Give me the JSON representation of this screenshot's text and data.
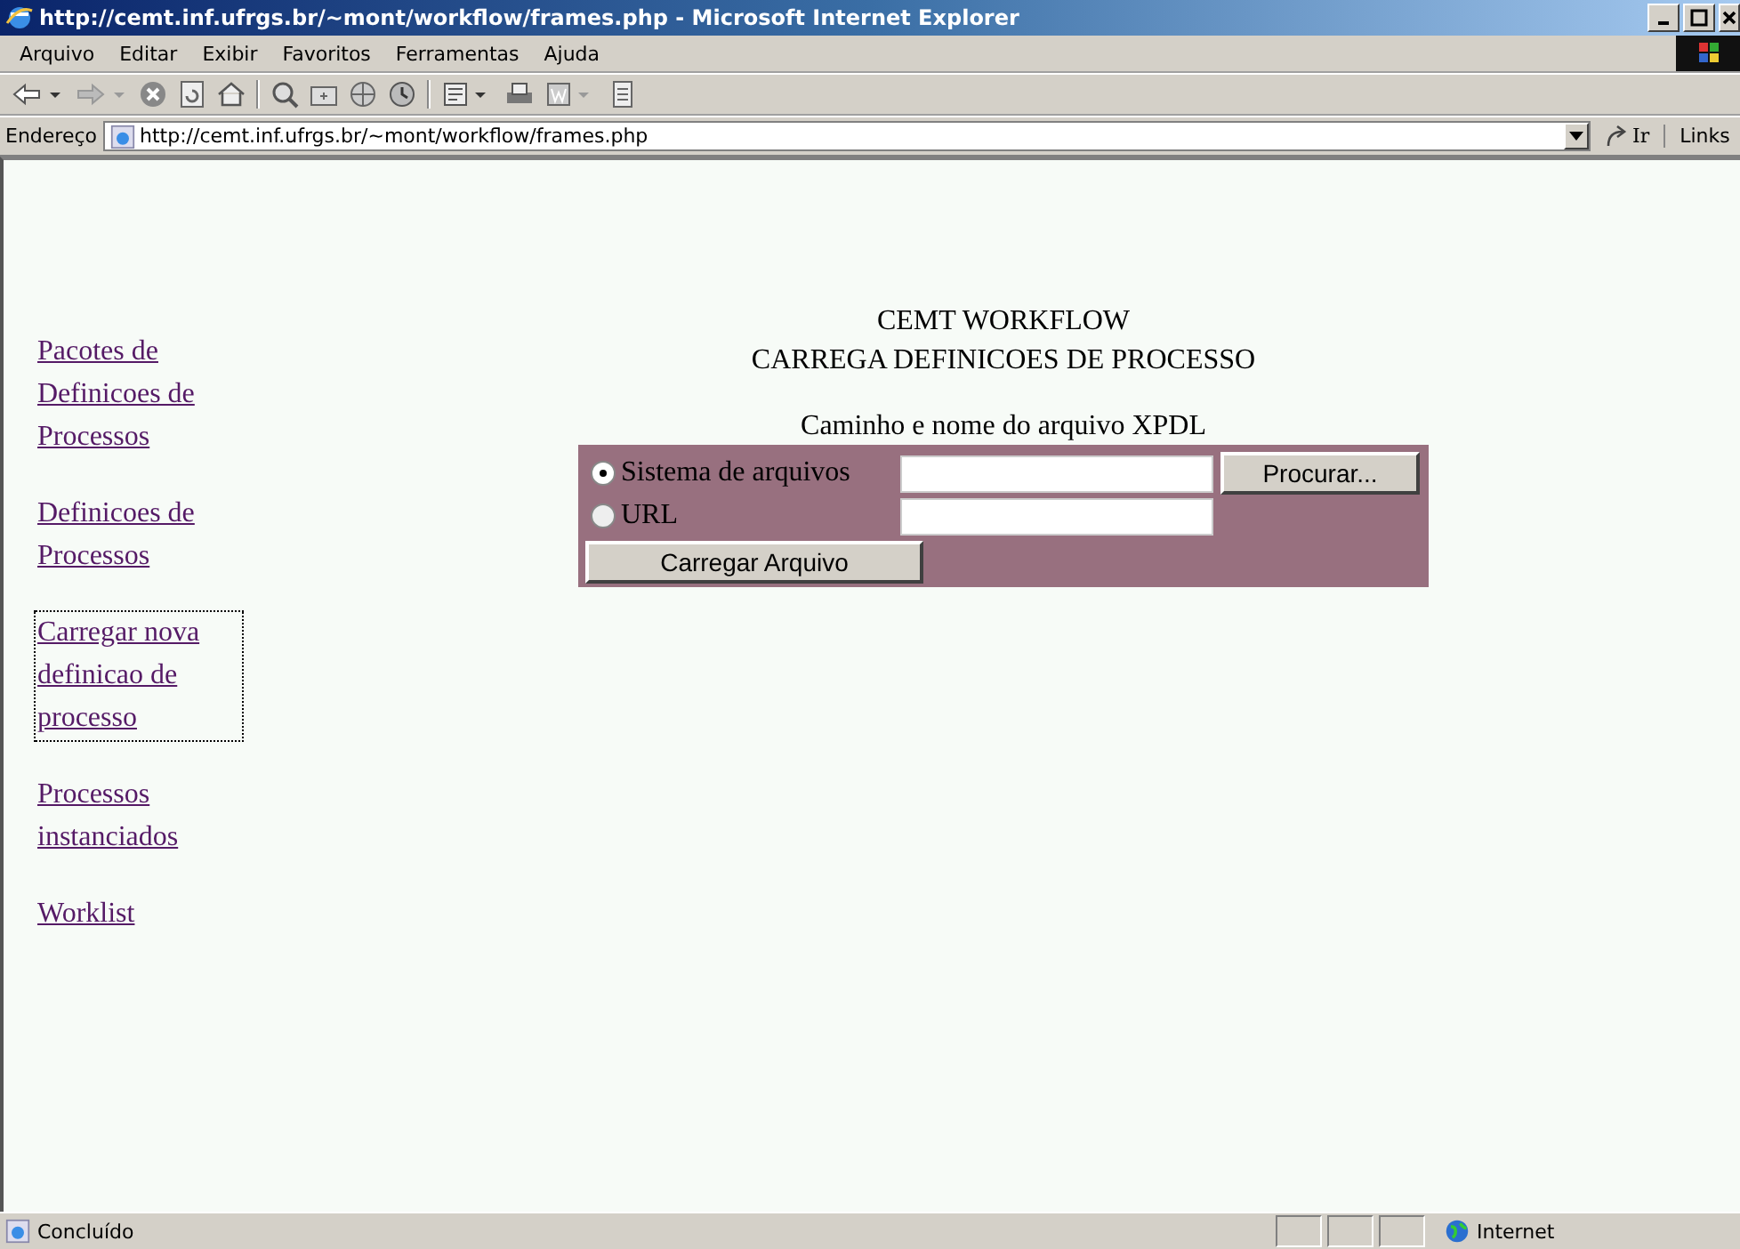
{
  "window": {
    "title": "http://cemt.inf.ufrgs.br/~mont/workflow/frames.php - Microsoft Internet Explorer"
  },
  "menu": [
    "Arquivo",
    "Editar",
    "Exibir",
    "Favoritos",
    "Ferramentas",
    "Ajuda"
  ],
  "address_bar": {
    "label": "Endereço",
    "value": "http://cemt.inf.ufrgs.br/~mont/workflow/frames.php",
    "go": "Ir",
    "links": "Links"
  },
  "sidebar": {
    "items": [
      {
        "label": "Pacotes de Definicoes de Processos",
        "selected": false
      },
      {
        "label": "Definicoes de Processos",
        "selected": false
      },
      {
        "label": "Carregar nova definicao de processo",
        "selected": true
      },
      {
        "label": "Processos instanciados",
        "selected": false
      },
      {
        "label": "Worklist",
        "selected": false
      }
    ]
  },
  "main": {
    "heading": "CEMT WORKFLOW",
    "subheading": "CARREGA DEFINICOES DE PROCESSO",
    "form_title": "Caminho e nome do arquivo XPDL",
    "options": [
      {
        "label": "Sistema de arquivos",
        "selected": true,
        "button": "Procurar..."
      },
      {
        "label": "URL",
        "selected": false
      }
    ],
    "submit": "Carregar Arquivo"
  },
  "status_bar": {
    "status": "Concluído",
    "zone": "Internet"
  }
}
